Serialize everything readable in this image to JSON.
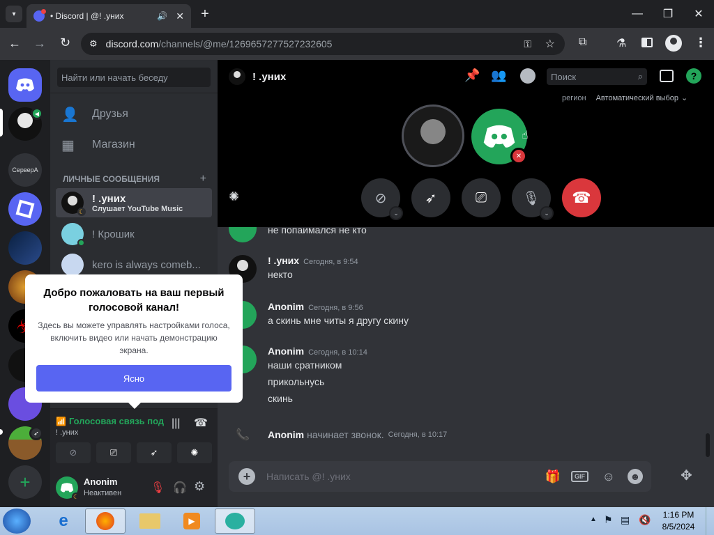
{
  "browser": {
    "tab_title": "• Discord | @! .уних",
    "url_domain": "discord.com",
    "url_path": "/channels/@me/1269657277527232605",
    "new_tab_icon": "plus-icon"
  },
  "dm_sidebar": {
    "search_placeholder": "Найти или начать беседу",
    "nav": [
      {
        "label": "Друзья",
        "icon": "friends-icon"
      },
      {
        "label": "Магазин",
        "icon": "shop-icon"
      }
    ],
    "section_title": "ЛИЧНЫЕ СООБЩЕНИЯ",
    "dms": [
      {
        "name": "! .уних",
        "status": "Слушает YouTube Music"
      },
      {
        "name": "! Крошик",
        "status": ""
      },
      {
        "name": "kero is always comeb...",
        "status": ""
      }
    ]
  },
  "servers": {
    "label_text_server": "СерверА"
  },
  "popup": {
    "title": "Добро пожаловать на ваш первый голосовой канал!",
    "body": "Здесь вы можете управлять настройками голоса, включить видео или начать демонстрацию экрана.",
    "button": "Ясно"
  },
  "voice_panel": {
    "status": "Голосовая связь под",
    "channel": "! .уних"
  },
  "user_panel": {
    "name": "Anonim",
    "status": "Неактивен"
  },
  "header": {
    "channel_name": "! .уних",
    "search_placeholder": "Поиск",
    "region_label": "регион",
    "region_value": "Автоматический выбор"
  },
  "messages": [
    {
      "author": "",
      "time": "",
      "lines": [
        "не попаимался не кто"
      ]
    },
    {
      "author": "! .уних",
      "time": "Сегодня, в 9:54",
      "lines": [
        "некто"
      ]
    },
    {
      "author": "Anonim",
      "time": "Сегодня, в 9:56",
      "lines": [
        "а скинь мне читы я другу скину"
      ]
    },
    {
      "author": "Anonim",
      "time": "Сегодня, в 10:14",
      "lines": [
        "наши сратником",
        "прикольнусь",
        "скинь"
      ]
    }
  ],
  "call_event": {
    "author": "Anonim",
    "text": "начинает звонок.",
    "time": "Сегодня, в 10:17"
  },
  "composer": {
    "placeholder": "Написать @! .уних",
    "gif_label": "GIF"
  },
  "taskbar": {
    "time": "1:16 PM",
    "date": "8/5/2024"
  },
  "colors": {
    "blurple": "#5865f2",
    "green": "#23a55a",
    "red": "#da373c",
    "dark": "#1e1f22"
  }
}
